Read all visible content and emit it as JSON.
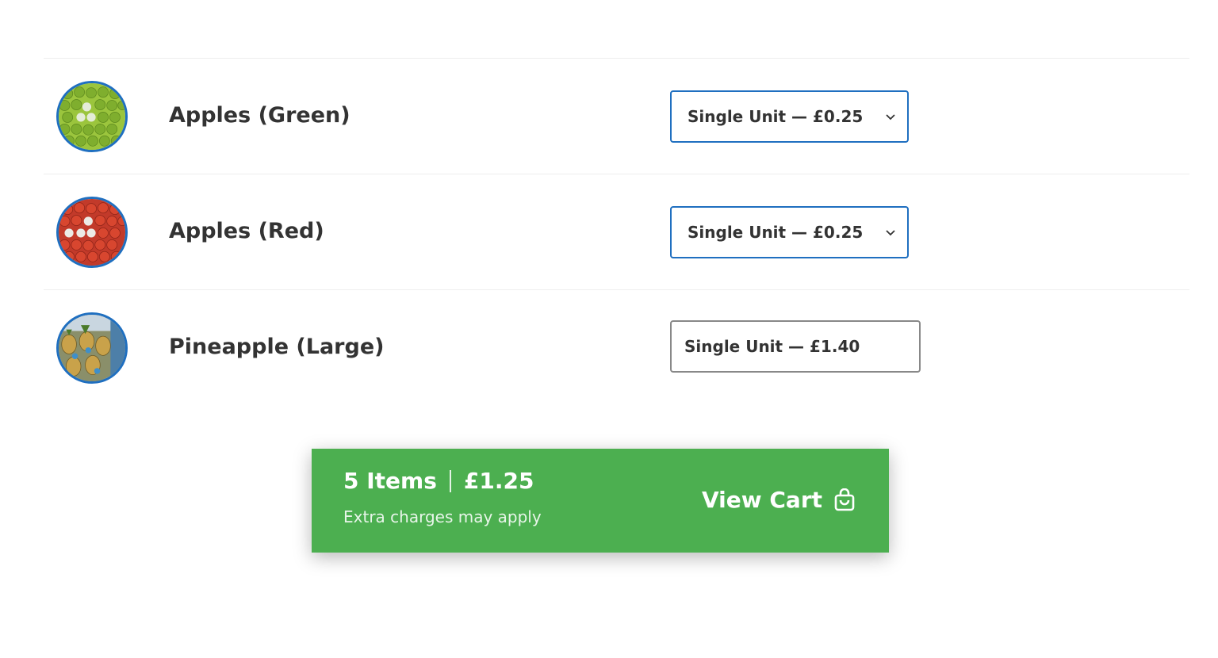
{
  "products": [
    {
      "name": "Apples (Green)",
      "image_icon": "green-apples-image",
      "option": "Single Unit — £0.25",
      "has_dropdown": true
    },
    {
      "name": "Apples (Red)",
      "image_icon": "red-apples-image",
      "option": "Single Unit — £0.25",
      "has_dropdown": true
    },
    {
      "name": "Pineapple (Large)",
      "image_icon": "pineapple-image",
      "option": "Single Unit — £1.40",
      "has_dropdown": false
    }
  ],
  "cart": {
    "items_label": "5 Items",
    "total": "£1.25",
    "note": "Extra charges may apply",
    "view_cart_label": "View Cart",
    "icon": "shopping-bag-icon"
  },
  "colors": {
    "accent_blue": "#1f6fc0",
    "cart_green": "#4caf50",
    "text": "#333333"
  }
}
